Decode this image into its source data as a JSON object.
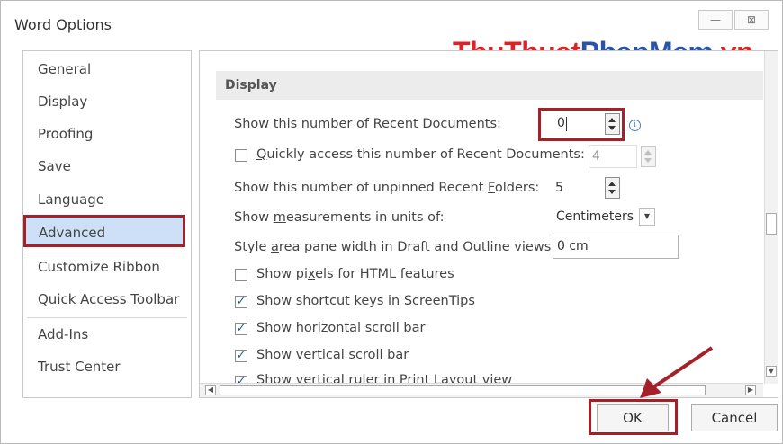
{
  "window": {
    "title": "Word Options",
    "minimize_glyph": "—",
    "close_glyph": "⊠"
  },
  "watermark": {
    "part1": "ThuThuat",
    "part2": "PhanMem",
    "part3": ".vn"
  },
  "sidebar": {
    "items": [
      {
        "label": "General"
      },
      {
        "label": "Display"
      },
      {
        "label": "Proofing"
      },
      {
        "label": "Save"
      },
      {
        "label": "Language"
      },
      {
        "label": "Advanced",
        "selected": true
      },
      {
        "label": "Customize Ribbon"
      },
      {
        "label": "Quick Access Toolbar"
      },
      {
        "label": "Add-Ins"
      },
      {
        "label": "Trust Center"
      }
    ]
  },
  "display": {
    "section_title": "Display",
    "recent_docs": {
      "label": "Show this number of Recent Documents:",
      "value": "0",
      "info_icon": "i"
    },
    "quick_access": {
      "label": "Quickly access this number of Recent Documents:",
      "value": "4",
      "checked": false
    },
    "unpinned_folders": {
      "label": "Show this number of unpinned Recent Folders:",
      "value": "5"
    },
    "measurements": {
      "label": "Show measurements in units of:",
      "value": "Centimeters"
    },
    "style_area": {
      "label": "Style area pane width in Draft and Outline views:",
      "value": "0 cm"
    },
    "pixels_html": {
      "label": "Show pixels for HTML features",
      "checked": false
    },
    "shortcut_keys": {
      "label": "Show shortcut keys in ScreenTips",
      "checked": true
    },
    "horizontal_scroll": {
      "label": "Show horizontal scroll bar",
      "checked": true
    },
    "vertical_scroll": {
      "label": "Show vertical scroll bar",
      "checked": true
    },
    "vertical_ruler": {
      "label": "Show vertical ruler in Print Layout view",
      "checked": true
    }
  },
  "buttons": {
    "ok": "OK",
    "cancel": "Cancel"
  },
  "colors": {
    "highlight_red": "#a5212a",
    "selected_bg": "#cde0f7",
    "watermark_red": "#d9242a",
    "watermark_blue": "#2a55a7"
  }
}
